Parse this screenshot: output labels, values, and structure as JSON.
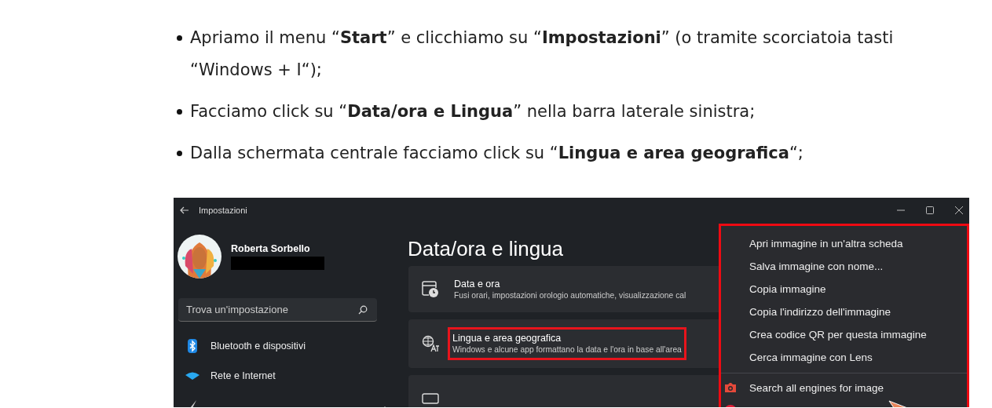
{
  "article": {
    "bullets": [
      "Apriamo il menu “**Start**” e clicchiamo su “**Impostazioni**” (o tramite scorciatoia tasti “Windows + I“);",
      "Facciamo click su “**Data/ora e Lingua**” nella barra laterale sinistra;",
      "Dalla schermata centrale facciamo click su “**Lingua e area geografica**“;"
    ]
  },
  "screenshot": {
    "title": "Impostazioni",
    "user": {
      "name": "Roberta Sorbello"
    },
    "search": {
      "placeholder": "Trova un'impostazione"
    },
    "nav": [
      {
        "label": "Bluetooth e dispositivi",
        "kind": "bluetooth"
      },
      {
        "label": "Rete e Internet",
        "kind": "wifi"
      },
      {
        "kind": "brush"
      }
    ],
    "page_title": "Data/ora e lingua",
    "cards": [
      {
        "title": "Data e ora",
        "subtitle": "Fusi orari, impostazioni orologio automatiche, visualizzazione cal",
        "kind": "clock",
        "highlighted": false
      },
      {
        "title": "Lingua e area geografica",
        "subtitle": "Windows e alcune app formattano la data e l'ora in base all'area",
        "kind": "language",
        "highlighted": true
      },
      {
        "kind": "keyboard",
        "highlighted": false
      }
    ],
    "context_menu": {
      "groups": [
        [
          {
            "label": "Apri immagine in un'altra scheda",
            "kind": "plain"
          },
          {
            "label": "Salva immagine con nome...",
            "kind": "plain"
          },
          {
            "label": "Copia immagine",
            "kind": "plain"
          },
          {
            "label": "Copia l'indirizzo dell'immagine",
            "kind": "plain"
          },
          {
            "label": "Crea codice QR per questa immagine",
            "kind": "plain"
          },
          {
            "label": "Cerca immagine con Lens",
            "kind": "plain"
          }
        ],
        [
          {
            "label": "Search all engines for image",
            "kind": "camera"
          },
          {
            "kind": "badge"
          }
        ]
      ]
    }
  }
}
